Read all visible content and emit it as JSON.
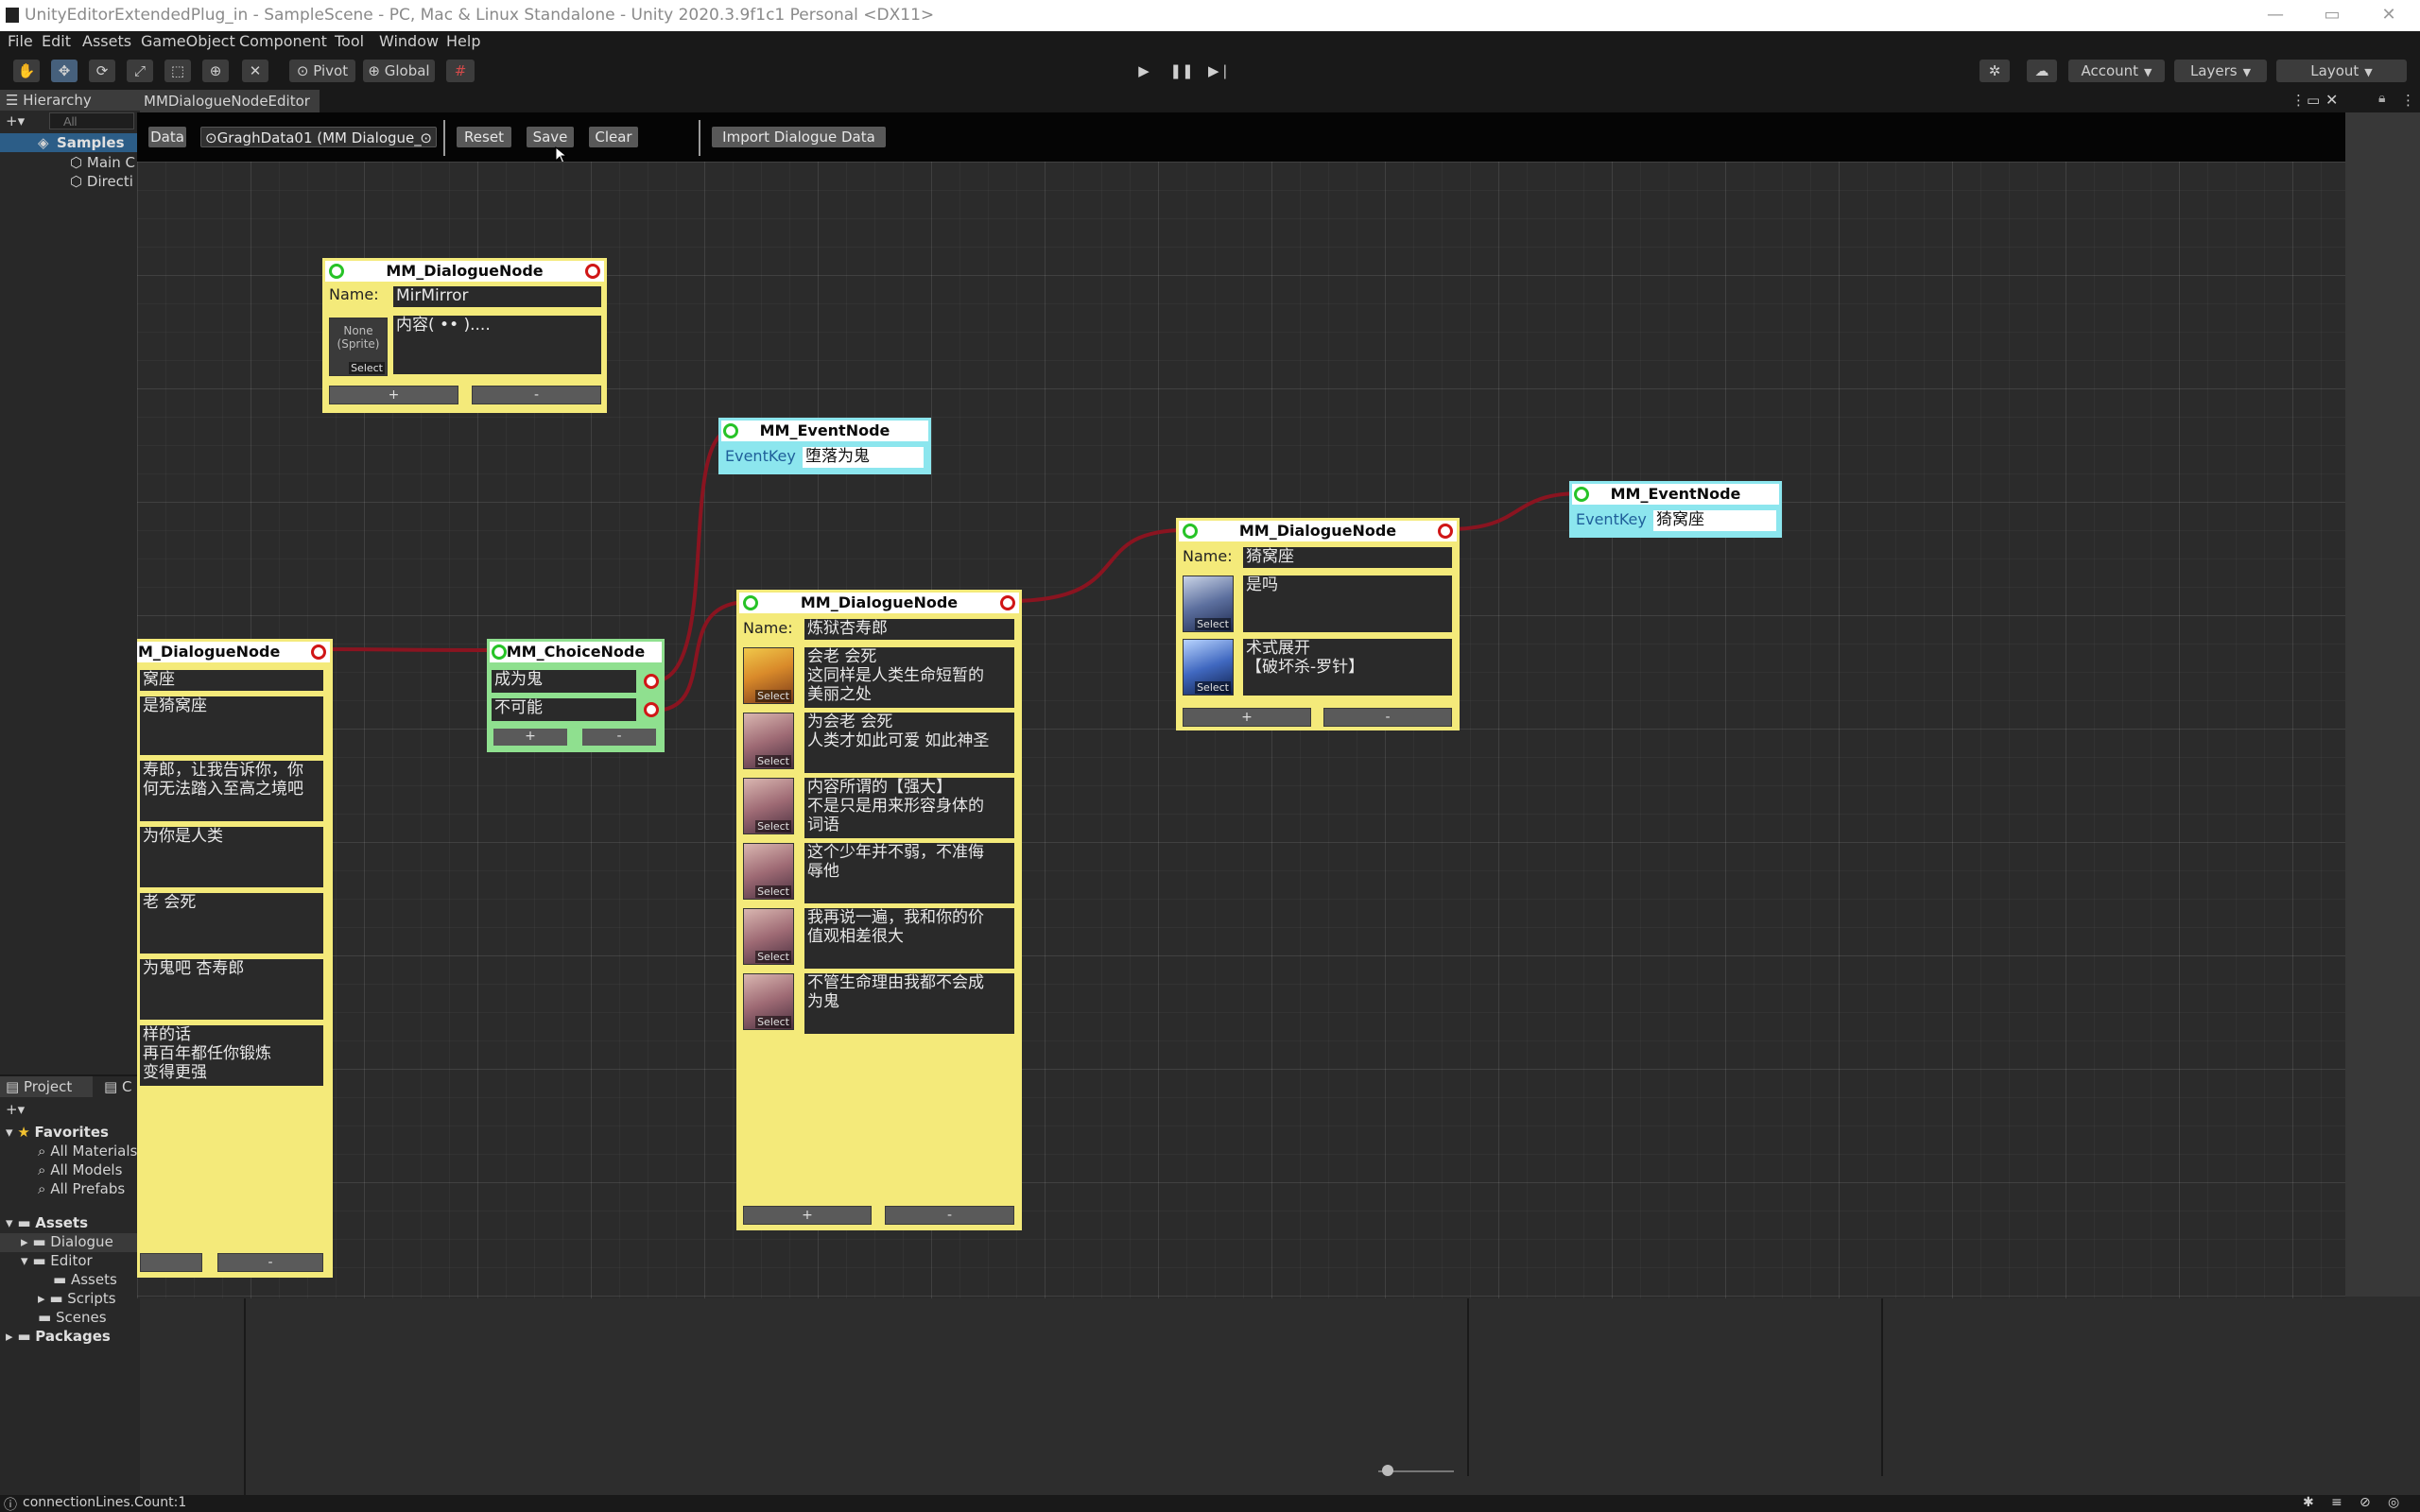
{
  "window": {
    "title": "UnityEditorExtendedPlug_in - SampleScene - PC, Mac & Linux Standalone - Unity 2020.3.9f1c1 Personal <DX11>",
    "minimize": "—",
    "maximize": "▭",
    "close": "✕"
  },
  "menu": [
    "File",
    "Edit",
    "Assets",
    "GameObject",
    "Component",
    "Tool",
    "Window",
    "Help"
  ],
  "toolbar": {
    "pivot": "Pivot",
    "global": "Global",
    "account": "Account",
    "layers": "Layers",
    "layout": "Layout"
  },
  "hierarchy": {
    "tab": "Hierarchy",
    "search_placeholder": "All",
    "scene": "Samples",
    "items": [
      "Main C",
      "Directi"
    ]
  },
  "project": {
    "tab": "Project",
    "tab2": "C",
    "favorites": "Favorites",
    "favorite_items": [
      "All Materials",
      "All Models",
      "All Prefabs"
    ],
    "assets": "Assets",
    "asset_items": [
      "Dialogue",
      "Editor",
      "Assets",
      "Scripts",
      "Scenes"
    ],
    "packages": "Packages"
  },
  "editor": {
    "tab": "MMDialogueNodeEditor",
    "data_label": "Data",
    "data_value": "GraghData01 (MM Dialogue_",
    "reset": "Reset",
    "save": "Save",
    "clear": "Clear",
    "import": "Import Dialogue Data"
  },
  "nodes": {
    "dialogue_top": {
      "title": "MM_DialogueNode",
      "name_label": "Name:",
      "name": "MirMirror",
      "sprite_none": "None\n(Sprite)",
      "select": "Select",
      "content": "内容( •• )....",
      "plus": "+",
      "minus": "-"
    },
    "event_1": {
      "title": "MM_EventNode",
      "key_label": "EventKey",
      "key": "堕落为鬼"
    },
    "event_2": {
      "title": "MM_EventNode",
      "key_label": "EventKey",
      "key": "猗窝座"
    },
    "choice": {
      "title": "MM_ChoiceNode",
      "options": [
        "成为鬼",
        "不可能"
      ],
      "plus": "+",
      "minus": "-"
    },
    "dialogue_left": {
      "title": "M_DialogueNode",
      "name": "窝座",
      "lines": [
        "是猗窝座",
        "寿郎，让我告诉你，你\n何无法踏入至高之境吧",
        "为你是人类",
        "老 会死",
        "为鬼吧 杏寿郎",
        "样的话\n再百年都任你锻炼\n变得更强"
      ],
      "minus": "-"
    },
    "dialogue_center": {
      "title": "MM_DialogueNode",
      "name_label": "Name:",
      "name": "炼狱杏寿郎",
      "select": "Select",
      "lines": [
        "会老 会死\n这同样是人类生命短暂的\n美丽之处",
        "为会老 会死\n人类才如此可爱 如此神圣",
        "内容所谓的【强大】\n不是只是用来形容身体的\n词语",
        "这个少年并不弱，不准侮\n辱他",
        "我再说一遍，我和你的价\n值观相差很大",
        "不管生命理由我都不会成\n为鬼"
      ],
      "plus": "+",
      "minus": "-"
    },
    "dialogue_right": {
      "title": "MM_DialogueNode",
      "name_label": "Name:",
      "name": "猗窝座",
      "select": "Select",
      "lines": [
        "是吗",
        "术式展开\n【破坏杀-罗针】"
      ],
      "plus": "+",
      "minus": "-"
    }
  },
  "status": {
    "text": "connectionLines.Count:1"
  },
  "colors": {
    "dialogue_node": "#f4ea7a",
    "choice_node": "#8fe08f",
    "event_node": "#8ce6ee",
    "wire": "#8a1420",
    "in_port": "#27c327",
    "out_port": "#d01616"
  }
}
